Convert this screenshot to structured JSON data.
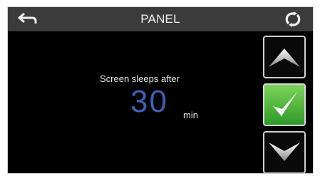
{
  "header": {
    "title": "PANEL"
  },
  "setting": {
    "label": "Screen sleeps after",
    "value": "30",
    "unit": "min"
  },
  "icons": {
    "back": "back-arrow-icon",
    "refresh": "refresh-icon",
    "up": "up-arrow-icon",
    "confirm": "checkmark-icon",
    "down": "down-arrow-icon"
  },
  "colors": {
    "header_bg": "#3b3b3b",
    "screen_bg": "#000000",
    "value_text": "#3f5fb5",
    "confirm_green": "#4cb63a"
  }
}
